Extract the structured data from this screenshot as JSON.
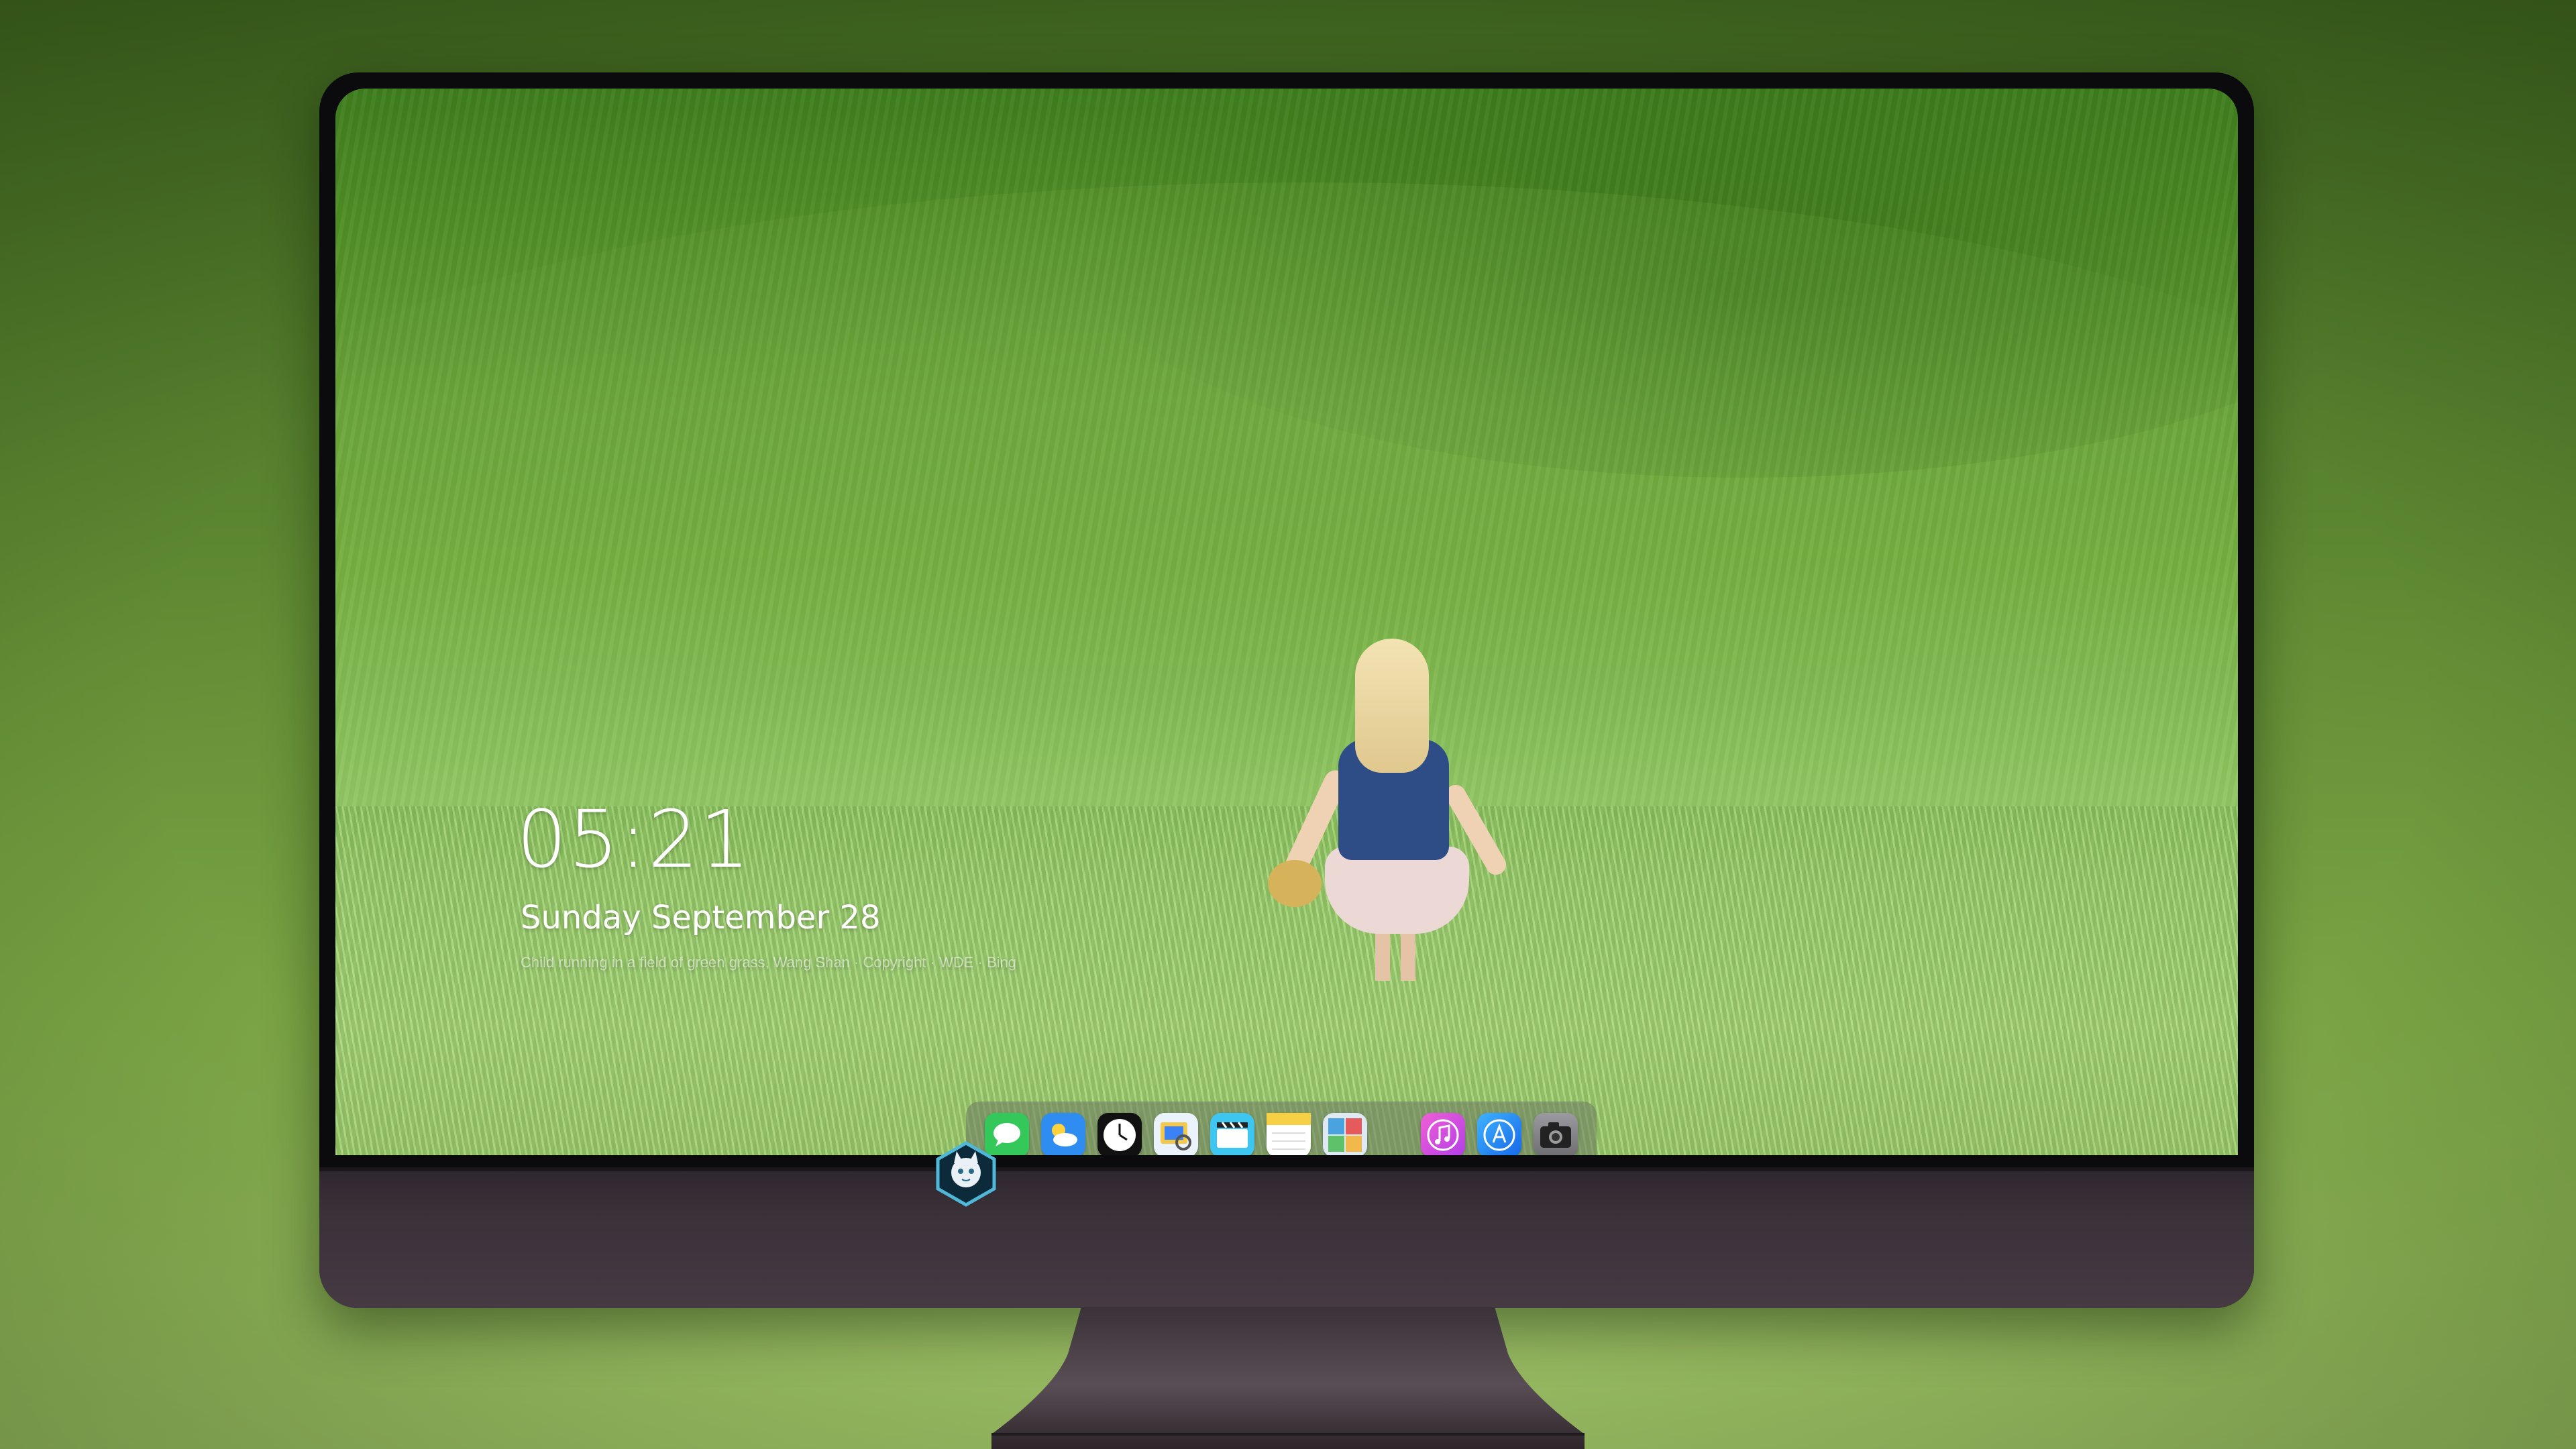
{
  "lockscreen": {
    "time": "05:21",
    "date": "Sunday September  28",
    "caption": "Child running in a field of green grass, Wang Shan · Copyright · WDE · Bing"
  },
  "dock": {
    "apps": [
      {
        "name": "Messages",
        "icon": "messages-icon",
        "color": "#34c759"
      },
      {
        "name": "Weather",
        "icon": "weather-icon",
        "color": "#2f8cf0"
      },
      {
        "name": "Clock",
        "icon": "clock-icon",
        "color": "#111111"
      },
      {
        "name": "Preview",
        "icon": "preview-icon",
        "color": "#f2c94c"
      },
      {
        "name": "Clips",
        "icon": "clips-icon",
        "color": "#3ec6f0"
      },
      {
        "name": "Notes",
        "icon": "notes-icon",
        "color": "#f7d046"
      },
      {
        "name": "Photo Booth",
        "icon": "photo-booth-icon",
        "color": "#4aa3df"
      },
      {
        "name": "iTunes",
        "icon": "itunes-icon",
        "color": "#e345d6"
      },
      {
        "name": "App Store",
        "icon": "app-store-icon",
        "color": "#1d8df5"
      },
      {
        "name": "Camera",
        "icon": "camera-icon",
        "color": "#8e8e93"
      }
    ]
  },
  "colors": {
    "bezel": "#0b0b0d",
    "chin": "#3b3139",
    "accent_green": "#6aa43a"
  }
}
